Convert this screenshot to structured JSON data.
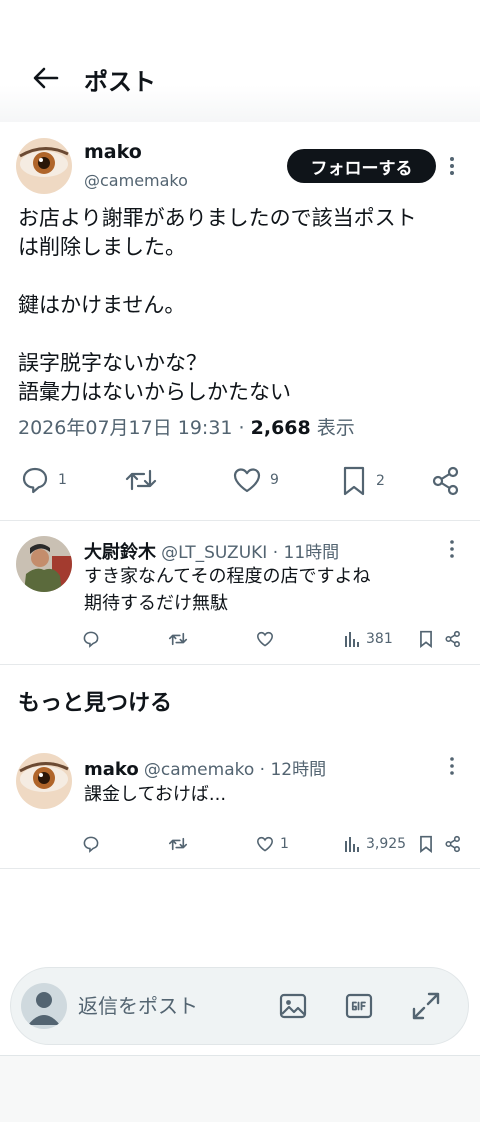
{
  "header": {
    "title": "ポスト"
  },
  "main_post": {
    "author_name": "mako",
    "author_handle": "@camemako",
    "follow_label": "フォローする",
    "text": "お店より謝罪がありましたので該当ポスト\nは削除しました。\n\n鍵はかけません。\n\n誤字脱字ないかな？\n語彙力はないからしかたない",
    "timestamp": "2026年07月17日 19:31",
    "separator": " · ",
    "views": "2,668",
    "views_label": " 表示",
    "reply_count": "1",
    "like_count": "9",
    "bookmark_count": "2"
  },
  "reply": {
    "author_name": "大尉鈴木",
    "author_handle": "@LT_SUZUKI",
    "time": " · 11時間",
    "text": "すき家なんてその程度の店ですよね\n期待するだけ無駄",
    "views": "381"
  },
  "discover": {
    "title": "もっと見つける",
    "post": {
      "author_name": "mako",
      "author_handle": "@camemako",
      "time": " · 12時間",
      "text": "課金しておけば...",
      "like_count": "1",
      "views": "3,925"
    }
  },
  "composer": {
    "placeholder": "返信をポスト"
  },
  "colors": {
    "primary_text": "#0f1419",
    "secondary_text": "#536471",
    "divider": "#e6e9eb",
    "composer_bg": "#eff3f4"
  }
}
